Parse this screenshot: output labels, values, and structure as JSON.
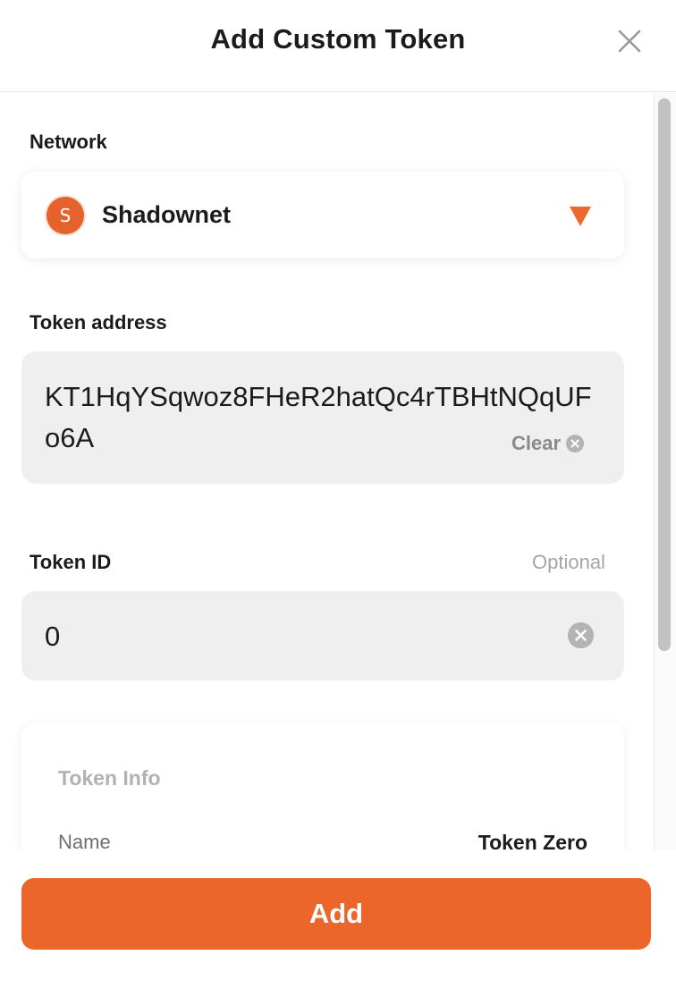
{
  "header": {
    "title": "Add Custom Token",
    "close_icon": "close-icon"
  },
  "network": {
    "label": "Network",
    "selected": "Shadownet",
    "avatar_letter": "S",
    "avatar_color": "#e5622f",
    "caret_icon": "chevron-down-icon"
  },
  "token_address": {
    "label": "Token address",
    "value": "KT1HqYSqwoz8FHeR2hatQc4rTBHtNQqUFo6A",
    "clear_label": "Clear"
  },
  "token_id": {
    "label": "Token ID",
    "optional_label": "Optional",
    "value": "0"
  },
  "token_info": {
    "title": "Token Info",
    "rows": [
      {
        "label": "Name",
        "value": "Token Zero"
      }
    ]
  },
  "footer": {
    "add_label": "Add"
  },
  "colors": {
    "accent": "#ec662c",
    "field_bg": "#efefef",
    "muted_text": "#a5a5a5"
  }
}
